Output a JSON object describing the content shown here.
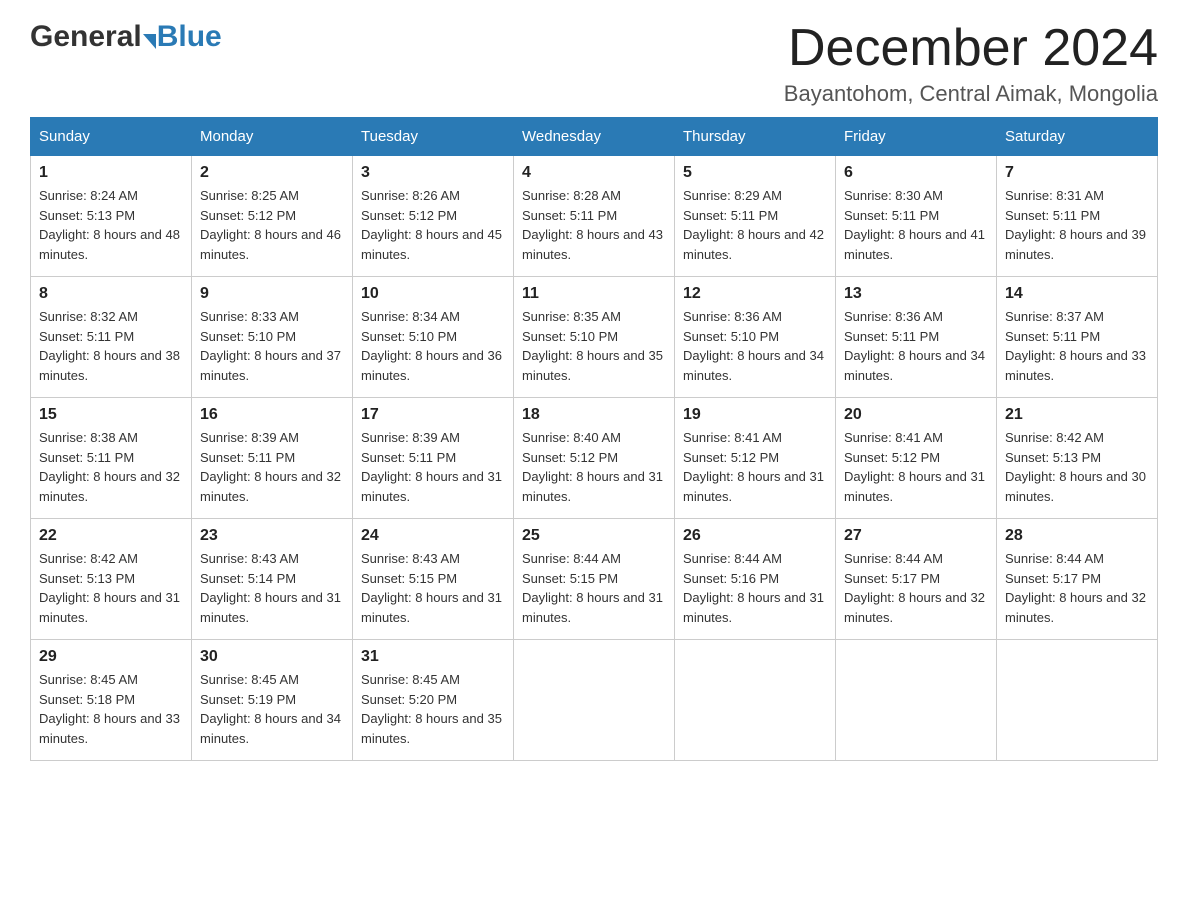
{
  "logo": {
    "general": "General",
    "blue": "Blue"
  },
  "header": {
    "month_year": "December 2024",
    "location": "Bayantohom, Central Aimak, Mongolia"
  },
  "columns": [
    "Sunday",
    "Monday",
    "Tuesday",
    "Wednesday",
    "Thursday",
    "Friday",
    "Saturday"
  ],
  "weeks": [
    [
      {
        "day": "1",
        "sunrise": "8:24 AM",
        "sunset": "5:13 PM",
        "daylight": "8 hours and 48 minutes."
      },
      {
        "day": "2",
        "sunrise": "8:25 AM",
        "sunset": "5:12 PM",
        "daylight": "8 hours and 46 minutes."
      },
      {
        "day": "3",
        "sunrise": "8:26 AM",
        "sunset": "5:12 PM",
        "daylight": "8 hours and 45 minutes."
      },
      {
        "day": "4",
        "sunrise": "8:28 AM",
        "sunset": "5:11 PM",
        "daylight": "8 hours and 43 minutes."
      },
      {
        "day": "5",
        "sunrise": "8:29 AM",
        "sunset": "5:11 PM",
        "daylight": "8 hours and 42 minutes."
      },
      {
        "day": "6",
        "sunrise": "8:30 AM",
        "sunset": "5:11 PM",
        "daylight": "8 hours and 41 minutes."
      },
      {
        "day": "7",
        "sunrise": "8:31 AM",
        "sunset": "5:11 PM",
        "daylight": "8 hours and 39 minutes."
      }
    ],
    [
      {
        "day": "8",
        "sunrise": "8:32 AM",
        "sunset": "5:11 PM",
        "daylight": "8 hours and 38 minutes."
      },
      {
        "day": "9",
        "sunrise": "8:33 AM",
        "sunset": "5:10 PM",
        "daylight": "8 hours and 37 minutes."
      },
      {
        "day": "10",
        "sunrise": "8:34 AM",
        "sunset": "5:10 PM",
        "daylight": "8 hours and 36 minutes."
      },
      {
        "day": "11",
        "sunrise": "8:35 AM",
        "sunset": "5:10 PM",
        "daylight": "8 hours and 35 minutes."
      },
      {
        "day": "12",
        "sunrise": "8:36 AM",
        "sunset": "5:10 PM",
        "daylight": "8 hours and 34 minutes."
      },
      {
        "day": "13",
        "sunrise": "8:36 AM",
        "sunset": "5:11 PM",
        "daylight": "8 hours and 34 minutes."
      },
      {
        "day": "14",
        "sunrise": "8:37 AM",
        "sunset": "5:11 PM",
        "daylight": "8 hours and 33 minutes."
      }
    ],
    [
      {
        "day": "15",
        "sunrise": "8:38 AM",
        "sunset": "5:11 PM",
        "daylight": "8 hours and 32 minutes."
      },
      {
        "day": "16",
        "sunrise": "8:39 AM",
        "sunset": "5:11 PM",
        "daylight": "8 hours and 32 minutes."
      },
      {
        "day": "17",
        "sunrise": "8:39 AM",
        "sunset": "5:11 PM",
        "daylight": "8 hours and 31 minutes."
      },
      {
        "day": "18",
        "sunrise": "8:40 AM",
        "sunset": "5:12 PM",
        "daylight": "8 hours and 31 minutes."
      },
      {
        "day": "19",
        "sunrise": "8:41 AM",
        "sunset": "5:12 PM",
        "daylight": "8 hours and 31 minutes."
      },
      {
        "day": "20",
        "sunrise": "8:41 AM",
        "sunset": "5:12 PM",
        "daylight": "8 hours and 31 minutes."
      },
      {
        "day": "21",
        "sunrise": "8:42 AM",
        "sunset": "5:13 PM",
        "daylight": "8 hours and 30 minutes."
      }
    ],
    [
      {
        "day": "22",
        "sunrise": "8:42 AM",
        "sunset": "5:13 PM",
        "daylight": "8 hours and 31 minutes."
      },
      {
        "day": "23",
        "sunrise": "8:43 AM",
        "sunset": "5:14 PM",
        "daylight": "8 hours and 31 minutes."
      },
      {
        "day": "24",
        "sunrise": "8:43 AM",
        "sunset": "5:15 PM",
        "daylight": "8 hours and 31 minutes."
      },
      {
        "day": "25",
        "sunrise": "8:44 AM",
        "sunset": "5:15 PM",
        "daylight": "8 hours and 31 minutes."
      },
      {
        "day": "26",
        "sunrise": "8:44 AM",
        "sunset": "5:16 PM",
        "daylight": "8 hours and 31 minutes."
      },
      {
        "day": "27",
        "sunrise": "8:44 AM",
        "sunset": "5:17 PM",
        "daylight": "8 hours and 32 minutes."
      },
      {
        "day": "28",
        "sunrise": "8:44 AM",
        "sunset": "5:17 PM",
        "daylight": "8 hours and 32 minutes."
      }
    ],
    [
      {
        "day": "29",
        "sunrise": "8:45 AM",
        "sunset": "5:18 PM",
        "daylight": "8 hours and 33 minutes."
      },
      {
        "day": "30",
        "sunrise": "8:45 AM",
        "sunset": "5:19 PM",
        "daylight": "8 hours and 34 minutes."
      },
      {
        "day": "31",
        "sunrise": "8:45 AM",
        "sunset": "5:20 PM",
        "daylight": "8 hours and 35 minutes."
      },
      null,
      null,
      null,
      null
    ]
  ]
}
